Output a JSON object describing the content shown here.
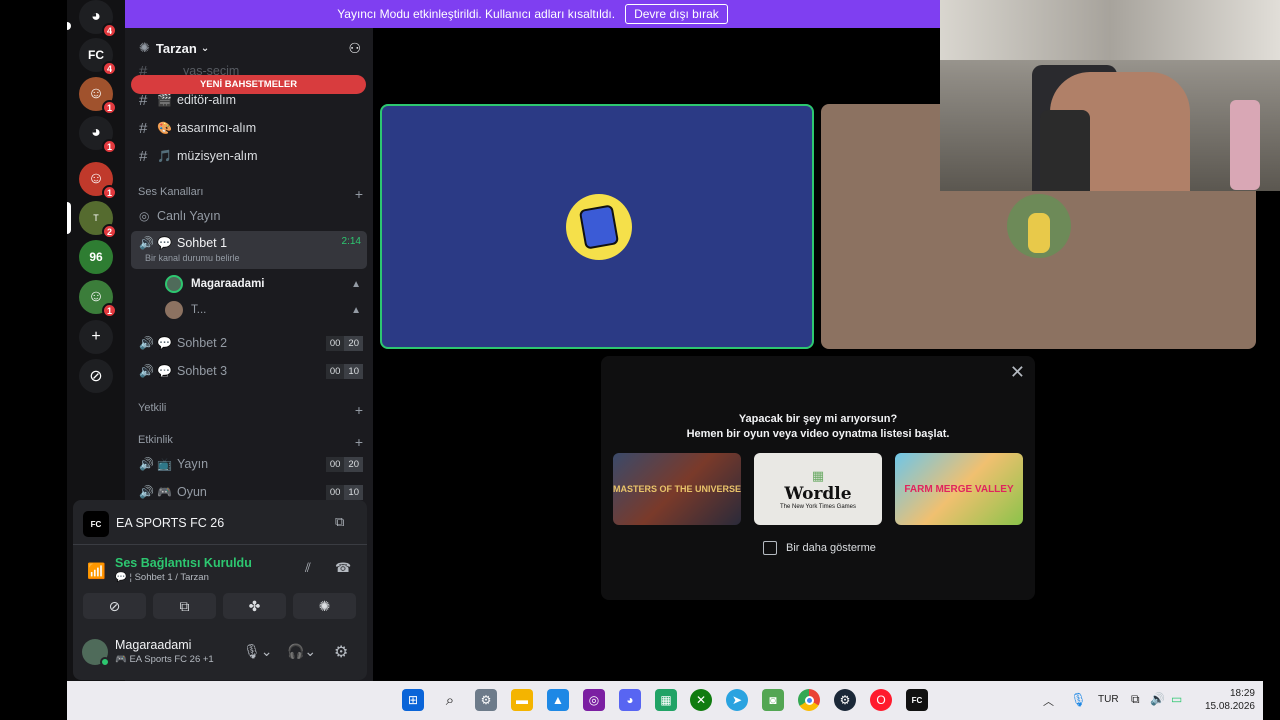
{
  "banner": {
    "text": "Yayıncı Modu etkinleştirildi. Kullanıcı adları kısaltıldı.",
    "button": "Devre dışı bırak"
  },
  "servers": [
    {
      "icon": "discord-icon",
      "badge": "4",
      "color": "#1e1f22"
    },
    {
      "icon": "fc-server-icon",
      "badge": "4",
      "color": "#1e1f22"
    },
    {
      "icon": "avatar",
      "badge": "1",
      "color": "#a0522d"
    },
    {
      "icon": "discord-icon",
      "badge": "1",
      "color": "#1e1f22"
    },
    {
      "icon": "avatar",
      "badge": "1",
      "color": "#c0392b"
    },
    {
      "icon": "tarzan-icon",
      "badge": "2",
      "color": "#556b2f"
    },
    {
      "icon": "96-icon",
      "badge": "",
      "color": "#2e7d32"
    },
    {
      "icon": "avatar",
      "badge": "1",
      "color": "#3b7d3a"
    }
  ],
  "guild": {
    "name": "Tarzan"
  },
  "mention_pill": "YENİ BAHSETMELER",
  "text_channels": [
    {
      "emoji": "🎬",
      "name": "editör-alım"
    },
    {
      "emoji": "🎨",
      "name": "tasarımcı-alım"
    },
    {
      "emoji": "🎵",
      "name": "müzisyen-alım"
    }
  ],
  "partial_channel": "yaş-seçim",
  "voice_category": "Ses Kanalları",
  "stage_channel": "Canlı Yayın",
  "active_channel": {
    "name": "Sohbet 1",
    "timer": "2:14",
    "status": "Bir kanal durumu belirle"
  },
  "members": [
    {
      "name": "Magaraadami"
    },
    {
      "name": "T..."
    }
  ],
  "other_voice": [
    {
      "name": "Sohbet 2",
      "a": "00",
      "b": "20"
    },
    {
      "name": "Sohbet 3",
      "a": "00",
      "b": "10"
    }
  ],
  "category_yetkili": "Yetkili",
  "category_etkinlik": "Etkinlik",
  "event_channels": [
    {
      "name": "Yayın",
      "a": "00",
      "b": "20"
    },
    {
      "name": "Oyun",
      "a": "00",
      "b": "10"
    }
  ],
  "activity_panel": {
    "game": "EA SPORTS FC 26"
  },
  "voice_status": {
    "title": "Ses Bağlantısı Kuruldu",
    "subtitle": "Sohbet 1 / Tarzan"
  },
  "user": {
    "name": "Magaraadami",
    "status": "EA Sports FC 26 +1"
  },
  "activity_popup": {
    "line1": "Yapacak bir şey mi arıyorsun?",
    "line2": "Hemen bir oyun veya video oynatma listesi başlat.",
    "games": [
      "MASTERS OF THE UNIVERSE",
      "Wordle",
      "FARM MERGE VALLEY"
    ],
    "wordle_sub": "The New York Times Games",
    "checkbox": "Bir daha gösterme"
  },
  "taskbar": {
    "lang": "TUR",
    "time": "18:29",
    "date": "15.08.2026"
  },
  "colors": {
    "accent": "#5865f2",
    "banner": "#7f3ff1",
    "green": "#2dc770",
    "red": "#e3393e"
  }
}
